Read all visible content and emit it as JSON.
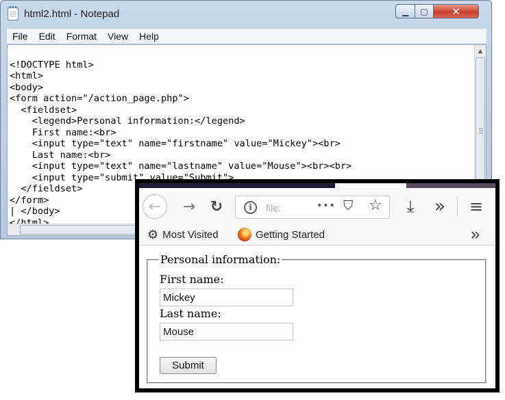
{
  "notepad": {
    "title": "html2.html - Notepad",
    "controls": {
      "minimize": "▁",
      "maximize": "▢",
      "close": "✕"
    },
    "menu": [
      "File",
      "Edit",
      "Format",
      "View",
      "Help"
    ],
    "code_lines": [
      "<!DOCTYPE html>",
      "<html>",
      "<body>",
      "<form action=\"/action_page.php\">",
      "  <fieldset>",
      "    <legend>Personal information:</legend>",
      "    First name:<br>",
      "    <input type=\"text\" name=\"firstname\" value=\"Mickey\"><br>",
      "    Last name:<br>",
      "    <input type=\"text\" name=\"lastname\" value=\"Mouse\"><br><br>",
      "    <input type=\"submit\" value=\"Submit\">",
      "  </fieldset>",
      "</form>",
      "| </body>",
      "</html>"
    ]
  },
  "firefox": {
    "toolbar": {
      "back_icon": "←",
      "forward_icon": "→",
      "reload_icon": "↻",
      "info_icon": "i",
      "url": "file:",
      "page_actions_icon": "•••",
      "pocket_icon": "⛉",
      "star_icon": "☆",
      "download_icon": "⤓",
      "overflow_icon": "»",
      "menu_icon": "≡"
    },
    "bookmarks": {
      "most_visited": "Most Visited",
      "getting_started": "Getting Started",
      "gear_icon": "⚙",
      "overflow_icon": "»"
    }
  },
  "form": {
    "legend": "Personal information:",
    "first_name_label": "First name:",
    "first_name_value": "Mickey",
    "last_name_label": "Last name:",
    "last_name_value": "Mouse",
    "submit_label": "Submit"
  }
}
